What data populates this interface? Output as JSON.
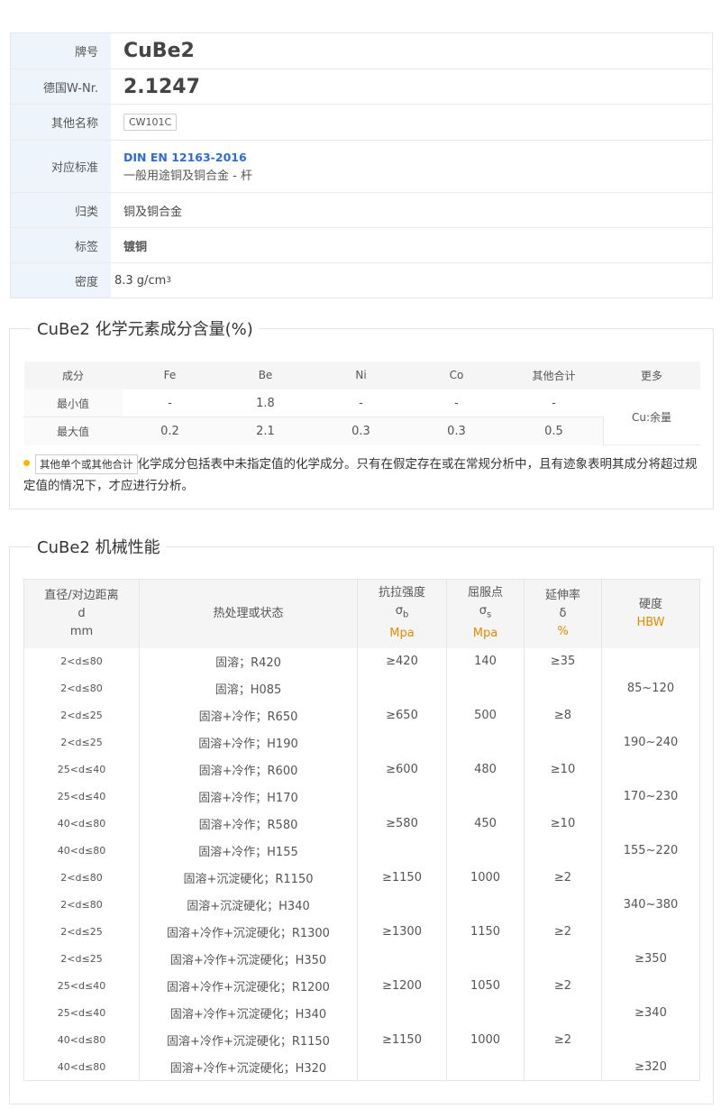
{
  "info": {
    "grade_label": "牌号",
    "grade_value": "CuBe2",
    "wnr_label": "德国W-Nr.",
    "wnr_value": "2.1247",
    "other_label": "其他名称",
    "other_value": "CW101C",
    "std_label": "对应标准",
    "std_code": "DIN EN 12163-2016",
    "std_desc": "一般用途铜及铜合金 - 杆",
    "class_label": "归类",
    "class_value": "铜及铜合金",
    "tag_label": "标签",
    "tag_value": "镀铜",
    "density_label": "密度",
    "density_value": "8.3 g/cm",
    "density_exp": "3"
  },
  "chem": {
    "title": "CuBe2 化学元素成分含量(%)",
    "headers": [
      "成分",
      "Fe",
      "Be",
      "Ni",
      "Co",
      "其他合计",
      "更多"
    ],
    "rows": [
      [
        "最小值",
        "-",
        "1.8",
        "-",
        "-",
        "-"
      ],
      [
        "最大值",
        "0.2",
        "2.1",
        "0.3",
        "0.3",
        "0.5"
      ]
    ],
    "more_value": "Cu:余量",
    "note_tag": "其他单个或其他合计",
    "note_text": "化学成分包括表中未指定值的化学成分。只有在假定存在或在常规分析中，且有迹象表明其成分将超过规定值的情况下，才应进行分析。"
  },
  "mech": {
    "title": "CuBe2 机械性能",
    "h_dia_1": "直径/对边距离",
    "h_dia_2": "d",
    "h_dia_3": "mm",
    "h_cond": "热处理或状态",
    "h_ts_1": "抗拉强度",
    "h_ts_sym": "σ",
    "h_ts_sub": "b",
    "h_ts_unit": "Mpa",
    "h_ys_1": "屈服点",
    "h_ys_sym": "σ",
    "h_ys_sub": "s",
    "h_ys_unit": "Mpa",
    "h_el_1": "延伸率",
    "h_el_sym": "δ",
    "h_el_unit": "%",
    "h_hb_1": "硬度",
    "h_hb_unit": "HBW",
    "rows": [
      [
        "2<d≤80",
        "固溶；R420",
        "≥420",
        "140",
        "≥35",
        ""
      ],
      [
        "2<d≤80",
        "固溶；H085",
        "",
        "",
        "",
        "85~120"
      ],
      [
        "2<d≤25",
        "固溶+冷作；R650",
        "≥650",
        "500",
        "≥8",
        ""
      ],
      [
        "2<d≤25",
        "固溶+冷作；H190",
        "",
        "",
        "",
        "190~240"
      ],
      [
        "25<d≤40",
        "固溶+冷作；R600",
        "≥600",
        "480",
        "≥10",
        ""
      ],
      [
        "25<d≤40",
        "固溶+冷作；H170",
        "",
        "",
        "",
        "170~230"
      ],
      [
        "40<d≤80",
        "固溶+冷作；R580",
        "≥580",
        "450",
        "≥10",
        ""
      ],
      [
        "40<d≤80",
        "固溶+冷作；H155",
        "",
        "",
        "",
        "155~220"
      ],
      [
        "2<d≤80",
        "固溶+沉淀硬化；R1150",
        "≥1150",
        "1000",
        "≥2",
        ""
      ],
      [
        "2<d≤80",
        "固溶+沉淀硬化；H340",
        "",
        "",
        "",
        "340~380"
      ],
      [
        "2<d≤25",
        "固溶+冷作+沉淀硬化；R1300",
        "≥1300",
        "1150",
        "≥2",
        ""
      ],
      [
        "2<d≤25",
        "固溶+冷作+沉淀硬化；H350",
        "",
        "",
        "",
        "≥350"
      ],
      [
        "25<d≤40",
        "固溶+冷作+沉淀硬化；R1200",
        "≥1200",
        "1050",
        "≥2",
        ""
      ],
      [
        "25<d≤40",
        "固溶+冷作+沉淀硬化；H340",
        "",
        "",
        "",
        "≥340"
      ],
      [
        "40<d≤80",
        "固溶+冷作+沉淀硬化；R1150",
        "≥1150",
        "1000",
        "≥2",
        ""
      ],
      [
        "40<d≤80",
        "固溶+冷作+沉淀硬化；H320",
        "",
        "",
        "",
        "≥320"
      ]
    ]
  }
}
